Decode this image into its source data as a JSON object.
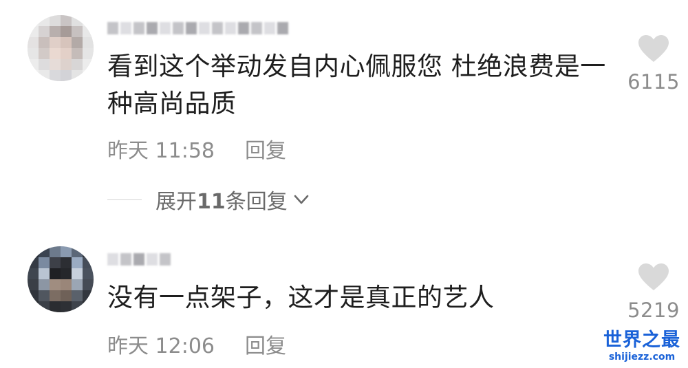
{
  "comments": [
    {
      "text": "看到这个举动发自内心佩服您 杜绝浪费是一种高尚品质",
      "time": "昨天 11:58",
      "reply_label": "回复",
      "likes": "6115",
      "expand": {
        "prefix": "展开",
        "count": "11",
        "suffix": "条回复"
      }
    },
    {
      "text": "没有一点架子，这才是真正的艺人",
      "time": "昨天 12:06",
      "reply_label": "回复",
      "likes": "5219"
    }
  ],
  "watermark": {
    "title": "世界之最",
    "url": "shijiezz.com"
  },
  "colors": {
    "text": "#1e1e1e",
    "meta": "#8c8c8c",
    "heart": "#d9d9d9",
    "watermark": "#1a62d8"
  },
  "icons": {
    "like": "heart-icon",
    "expand": "chevron-down-icon"
  }
}
